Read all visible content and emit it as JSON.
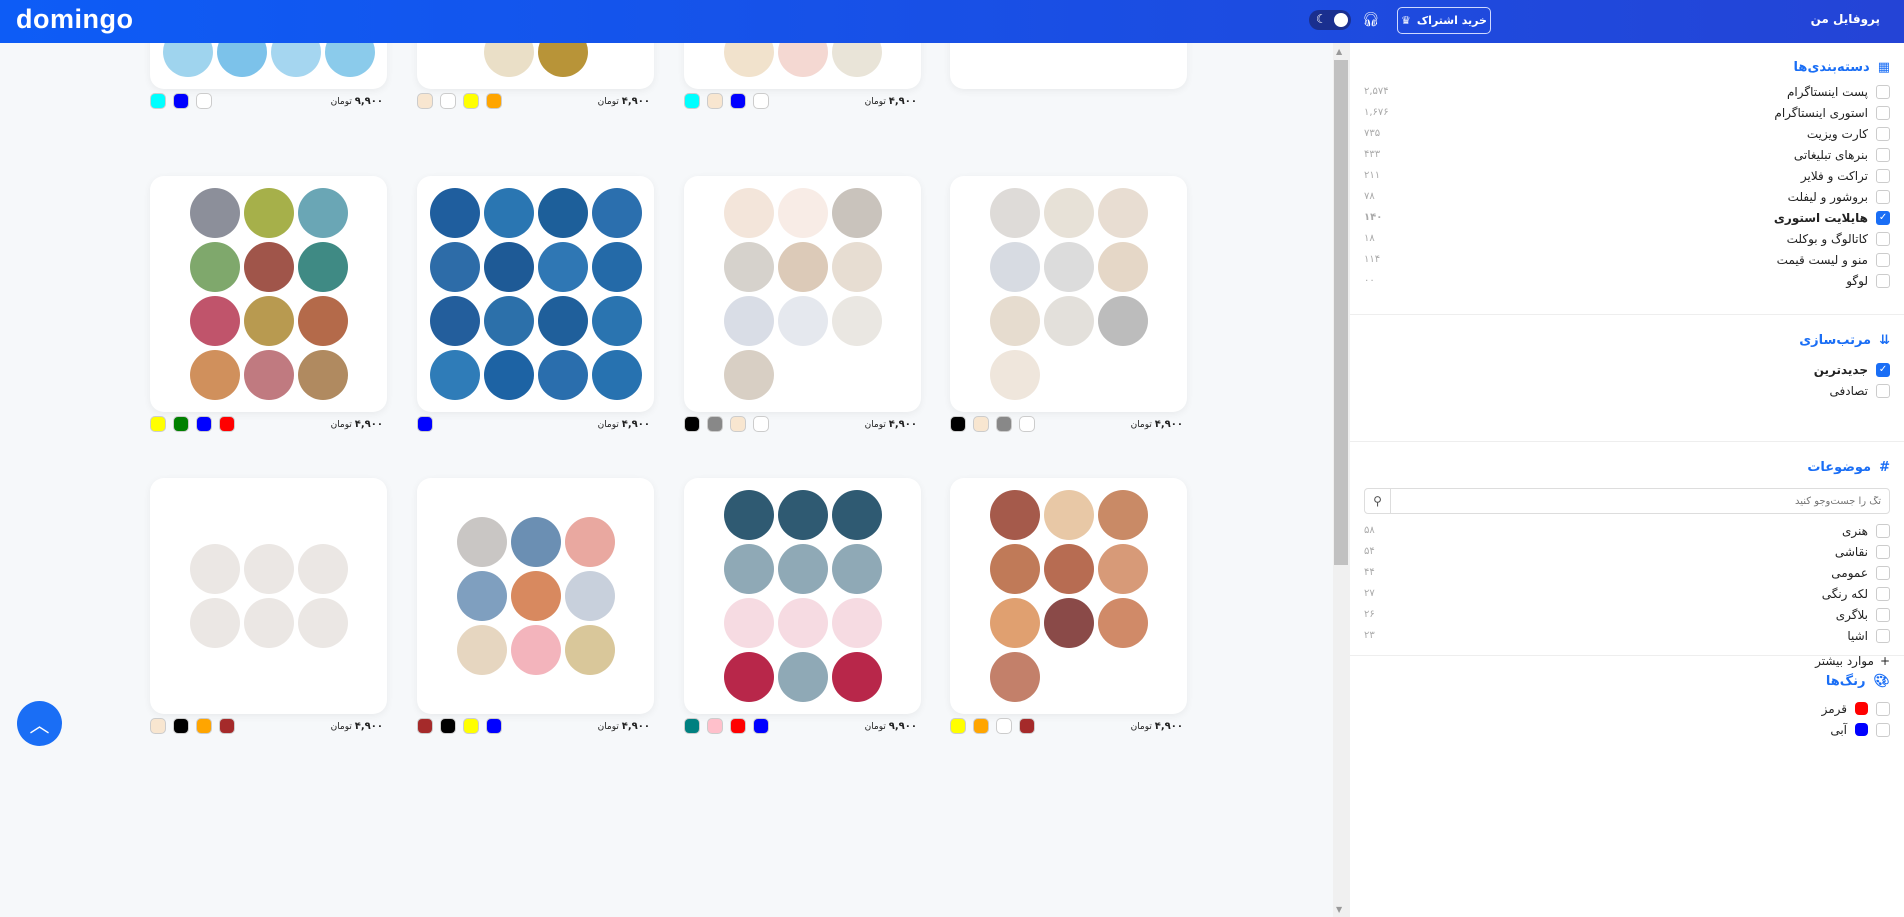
{
  "header": {
    "logo": "domingo",
    "profile": "پروفایل من",
    "subscribe": "خرید اشتراک",
    "accent": "#0d5cf6"
  },
  "cards": [
    {
      "price": "۹,۹۰۰",
      "currency": "تومان",
      "swatches": [
        "#00ffff",
        "#0000ff",
        "#ffffff"
      ],
      "cols": 4,
      "circles": [
        "#9fd4ee",
        "#7cc2ea",
        "#a5d6f0",
        "#8bcbeb"
      ]
    },
    {
      "price": "۴,۹۰۰",
      "currency": "تومان",
      "swatches": [
        "#f8e6d0",
        "#ffffff",
        "#ffff00",
        "#ffa500"
      ],
      "cols": 2,
      "circles": [
        "#eadfc7",
        "#b89438"
      ]
    },
    {
      "price": "۴,۹۰۰",
      "currency": "تومان",
      "swatches": [
        "#00ffff",
        "#f8e6d0",
        "#0000ff",
        "#ffffff"
      ],
      "cols": 3,
      "circles": [
        "#f1e2cc",
        "#f4d8d2",
        "#e9e4d8"
      ]
    },
    {
      "price": "",
      "currency": "",
      "swatches": [],
      "cols": 1,
      "circles": []
    },
    {
      "price": "۴,۹۰۰",
      "currency": "تومان",
      "swatches": [
        "#ffff00",
        "#008000",
        "#0000ff",
        "#ff0000"
      ],
      "cols": 3,
      "circles": [
        "#8c8f9a",
        "#a6b04a",
        "#6aa6b5",
        "#7fa86c",
        "#a0554a",
        "#3f8a84",
        "#c0546b",
        "#b89a50",
        "#b46a4a",
        "#d0905c",
        "#c07a80",
        "#b08a60"
      ]
    },
    {
      "price": "۴,۹۰۰",
      "currency": "تومان",
      "swatches": [
        "#0000ff"
      ],
      "cols": 4,
      "circles": [
        "#1f5e9e",
        "#2a76b2",
        "#1d5f9a",
        "#2b6fae",
        "#2d6ca8",
        "#1e5a96",
        "#2f77b4",
        "#246aa8",
        "#235e9c",
        "#2c70aa",
        "#1f5f9b",
        "#2a74b0",
        "#2f7cb8",
        "#1d63a4",
        "#2a6ead",
        "#2772b0"
      ]
    },
    {
      "price": "۴,۹۰۰",
      "currency": "تومان",
      "swatches": [
        "#000000",
        "#888888",
        "#f8e6d0",
        "#ffffff"
      ],
      "cols": 3,
      "circles": [
        "#f3e5da",
        "#f8ece6",
        "#c9c3bc",
        "#d6d2cc",
        "#dccab8",
        "#e7ddd2",
        "#d9dde6",
        "#e5e8ee",
        "#eae7e2",
        "#d8cfc4"
      ]
    },
    {
      "price": "۴,۹۰۰",
      "currency": "تومان",
      "swatches": [
        "#000000",
        "#f8e6d0",
        "#888888",
        "#ffffff"
      ],
      "cols": 3,
      "circles": [
        "#dedbd8",
        "#e7e1d7",
        "#e8ddd2",
        "#d7dbe2",
        "#dcdcdc",
        "#e5d7c7",
        "#e6dccf",
        "#e3e0db",
        "#bcbcbc",
        "#efe6dc"
      ]
    },
    {
      "price": "۴,۹۰۰",
      "currency": "تومان",
      "swatches": [
        "#f8e6d0",
        "#000000",
        "#ffa500",
        "#a52a2a"
      ],
      "cols": 3,
      "circles": [
        "#ebe7e4",
        "#ebe7e4",
        "#ebe7e4",
        "#ebe7e4",
        "#ebe7e4",
        "#ebe7e4"
      ]
    },
    {
      "price": "۴,۹۰۰",
      "currency": "تومان",
      "swatches": [
        "#a52a2a",
        "#000000",
        "#ffff00",
        "#0000ff"
      ],
      "cols": 3,
      "circles": [
        "#c9c6c4",
        "#6b8fb3",
        "#e9a8a0",
        "#7f9fbf",
        "#d8895f",
        "#c8d0dc",
        "#e6d6c0",
        "#f3b4bc",
        "#d9c79a"
      ]
    },
    {
      "price": "۹,۹۰۰",
      "currency": "تومان",
      "swatches": [
        "#008080",
        "#ffc0cb",
        "#ff0000",
        "#0000ff"
      ],
      "cols": 3,
      "circles": [
        "#2f5a72",
        "#2f5a72",
        "#2f5a72",
        "#8fa9b6",
        "#8fa9b6",
        "#8fa9b6",
        "#f6dbe2",
        "#f6dbe2",
        "#f6dbe2",
        "#b8274a",
        "#8fa9b6",
        "#b8274a"
      ]
    },
    {
      "price": "۴,۹۰۰",
      "currency": "تومان",
      "swatches": [
        "#ffff00",
        "#ffa500",
        "#ffffff",
        "#a52a2a"
      ],
      "cols": 3,
      "circles": [
        "#a55a4b",
        "#e8c8a6",
        "#c98a66",
        "#c07a58",
        "#b76c52",
        "#d79a78",
        "#e0a070",
        "#8a4a48",
        "#d08a68",
        "#c3806a"
      ]
    }
  ],
  "sidebar": {
    "categories": {
      "title": "دسته‌بندی‌ها",
      "items": [
        {
          "label": "پست اینستاگرام",
          "count": "۲,۵۷۴",
          "checked": false
        },
        {
          "label": "استوری اینستاگرام",
          "count": "۱,۶۷۶",
          "checked": false
        },
        {
          "label": "کارت ویزیت",
          "count": "۷۳۵",
          "checked": false
        },
        {
          "label": "بنرهای تبلیغاتی",
          "count": "۴۳۳",
          "checked": false
        },
        {
          "label": "تراکت و فلایر",
          "count": "۲۱۱",
          "checked": false
        },
        {
          "label": "بروشور و لیفلت",
          "count": "۷۸",
          "checked": false
        },
        {
          "label": "هایلایت استوری",
          "count": "۱۴۰",
          "checked": true
        },
        {
          "label": "کاتالوگ و بوکلت",
          "count": "۱۸",
          "checked": false
        },
        {
          "label": "منو و لیست قیمت",
          "count": "۱۱۴",
          "checked": false
        },
        {
          "label": "لوگو",
          "count": "۰۰",
          "checked": false
        }
      ]
    },
    "sort": {
      "title": "مرتب‌سازی",
      "items": [
        {
          "label": "جدیدترین",
          "checked": true
        },
        {
          "label": "تصادفی",
          "checked": false
        }
      ]
    },
    "topics": {
      "title": "موضوعات",
      "placeholder": "تگ را جست‌وجو کنید",
      "items": [
        {
          "label": "هنری",
          "count": "۵۸"
        },
        {
          "label": "نقاشی",
          "count": "۵۴"
        },
        {
          "label": "عمومی",
          "count": "۴۴"
        },
        {
          "label": "لکه رنگی",
          "count": "۲۷"
        },
        {
          "label": "بلاگری",
          "count": "۲۶"
        },
        {
          "label": "اشیا",
          "count": "۲۳"
        }
      ],
      "more": "موارد بیشتر"
    },
    "colors": {
      "title": "رنگ‌ها",
      "items": [
        {
          "label": "قرمز",
          "color": "#ff0000"
        },
        {
          "label": "آبی",
          "color": "#0000ff"
        }
      ]
    }
  }
}
